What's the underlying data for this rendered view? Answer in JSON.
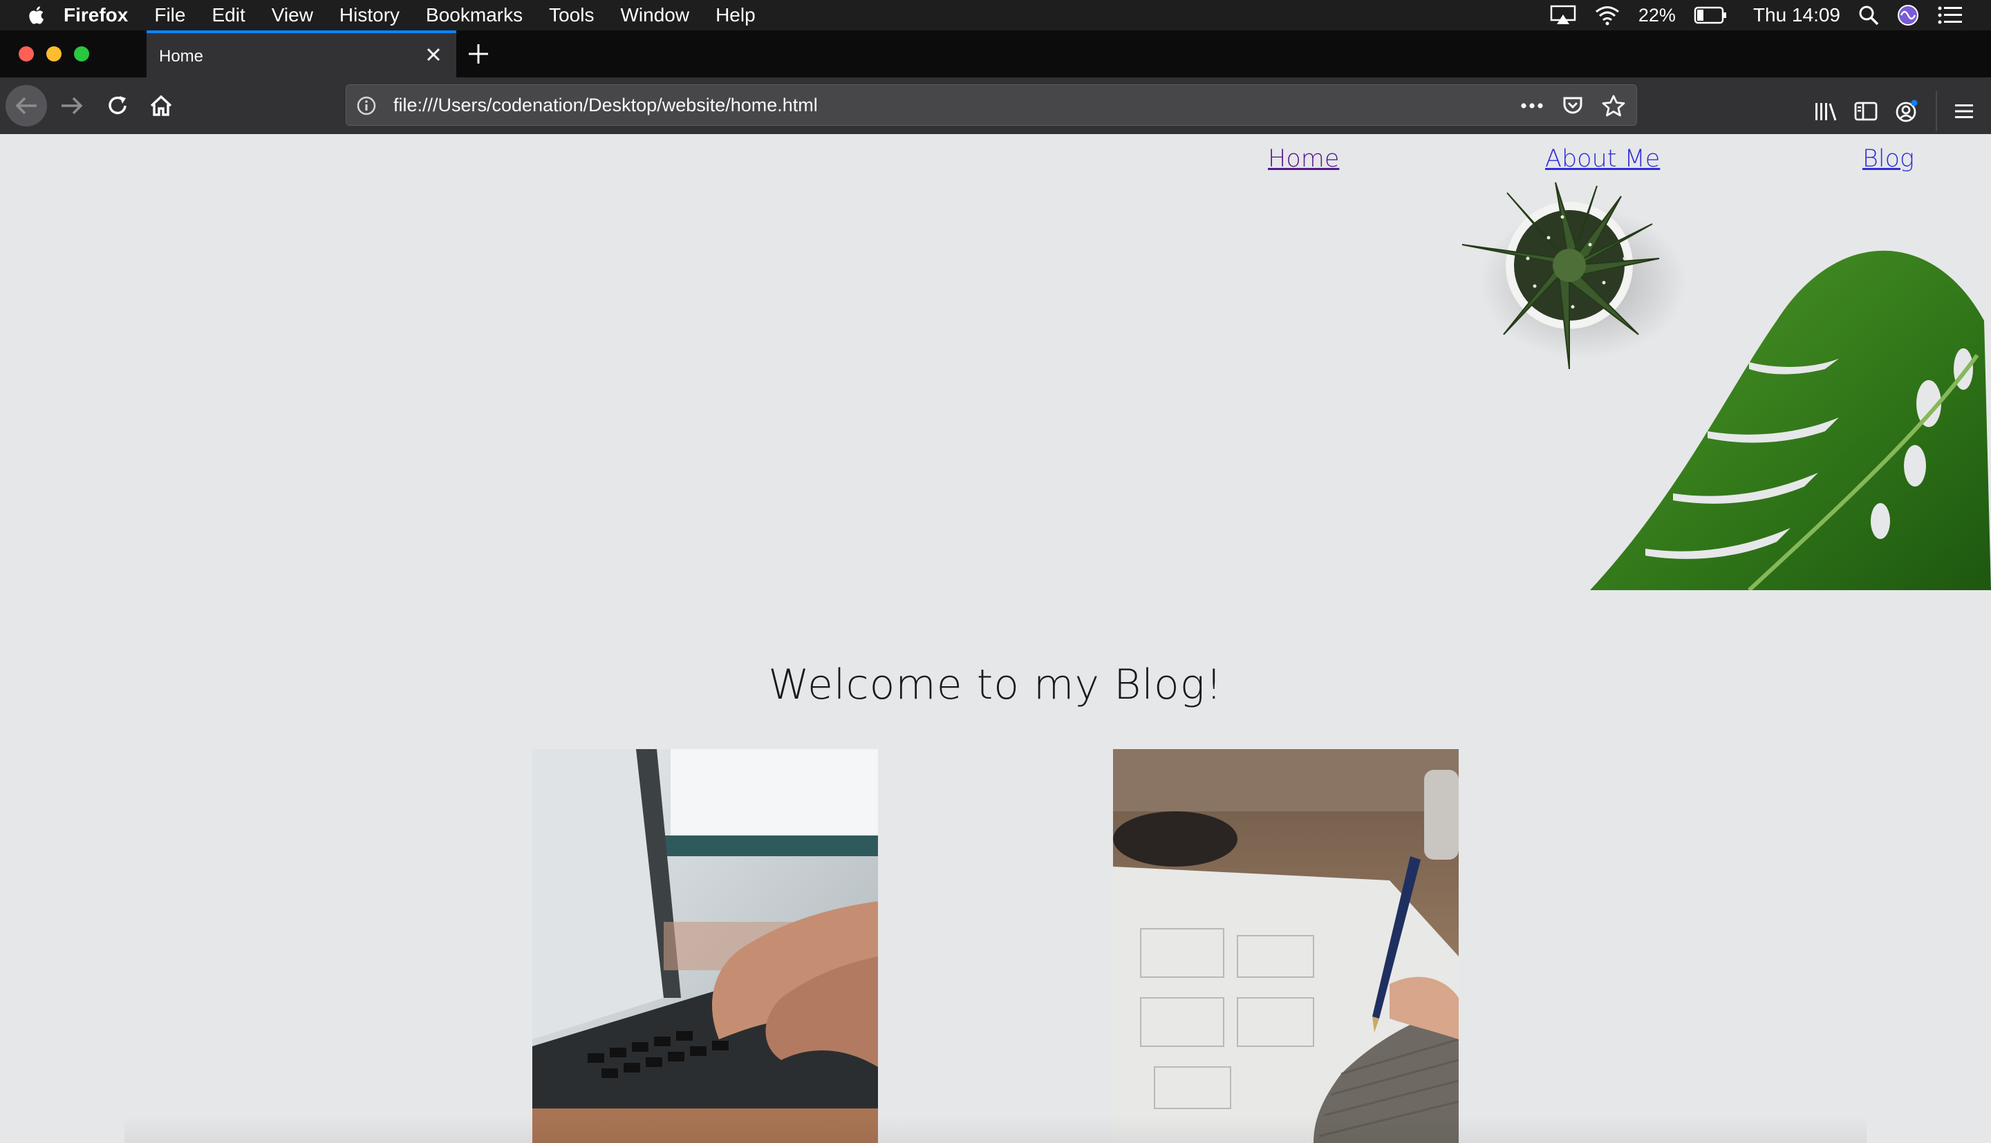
{
  "menubar": {
    "app_name": "Firefox",
    "items": [
      "File",
      "Edit",
      "View",
      "History",
      "Bookmarks",
      "Tools",
      "Window",
      "Help"
    ],
    "battery": "22%",
    "clock": "Thu 14:09"
  },
  "browser": {
    "tab_title": "Home",
    "url": "file:///Users/codenation/Desktop/website/home.html",
    "colors": {
      "tab_accent": "#0a84ff",
      "toolbar": "#323234",
      "urlbar": "#474749"
    }
  },
  "page": {
    "nav": {
      "home": "Home",
      "about": "About Me",
      "blog": "Blog"
    },
    "heading": "Welcome to my Blog!",
    "colors": {
      "background": "#e6e7e9",
      "visited_link": "#551a8b",
      "link": "#2f2fd6"
    }
  }
}
